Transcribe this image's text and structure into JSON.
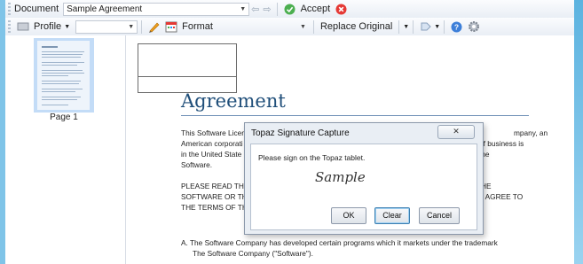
{
  "toolbar1": {
    "document_label": "Document",
    "document_value": "Sample Agreement",
    "accept_label": "Accept"
  },
  "toolbar2": {
    "profile_label": "Profile",
    "format_label": "Format",
    "replace_label": "Replace Original"
  },
  "thumbnails": [
    {
      "label": "Page 1"
    }
  ],
  "document": {
    "title": "Agreement",
    "para1": [
      "This Software Licen",
      "American corporati",
      "in the United State",
      "Software."
    ],
    "para1_right": [
      "mpany, an",
      "of business is",
      "the"
    ],
    "para2": [
      "PLEASE READ THIS",
      "SOFTWARE OR THI",
      "THE TERMS OF THI"
    ],
    "para2_right": [
      "HE",
      ") AGREE TO"
    ],
    "item_a_line1": "A.  The Software Company has developed certain programs which it markets under the trademark",
    "item_a_line2": "The Software Company (\"Software\")."
  },
  "dialog": {
    "title": "Topaz Signature Capture",
    "prompt": "Please sign on the Topaz tablet.",
    "signature": "Sample",
    "ok_label": "OK",
    "clear_label": "Clear",
    "cancel_label": "Cancel",
    "close_glyph": "✕"
  }
}
